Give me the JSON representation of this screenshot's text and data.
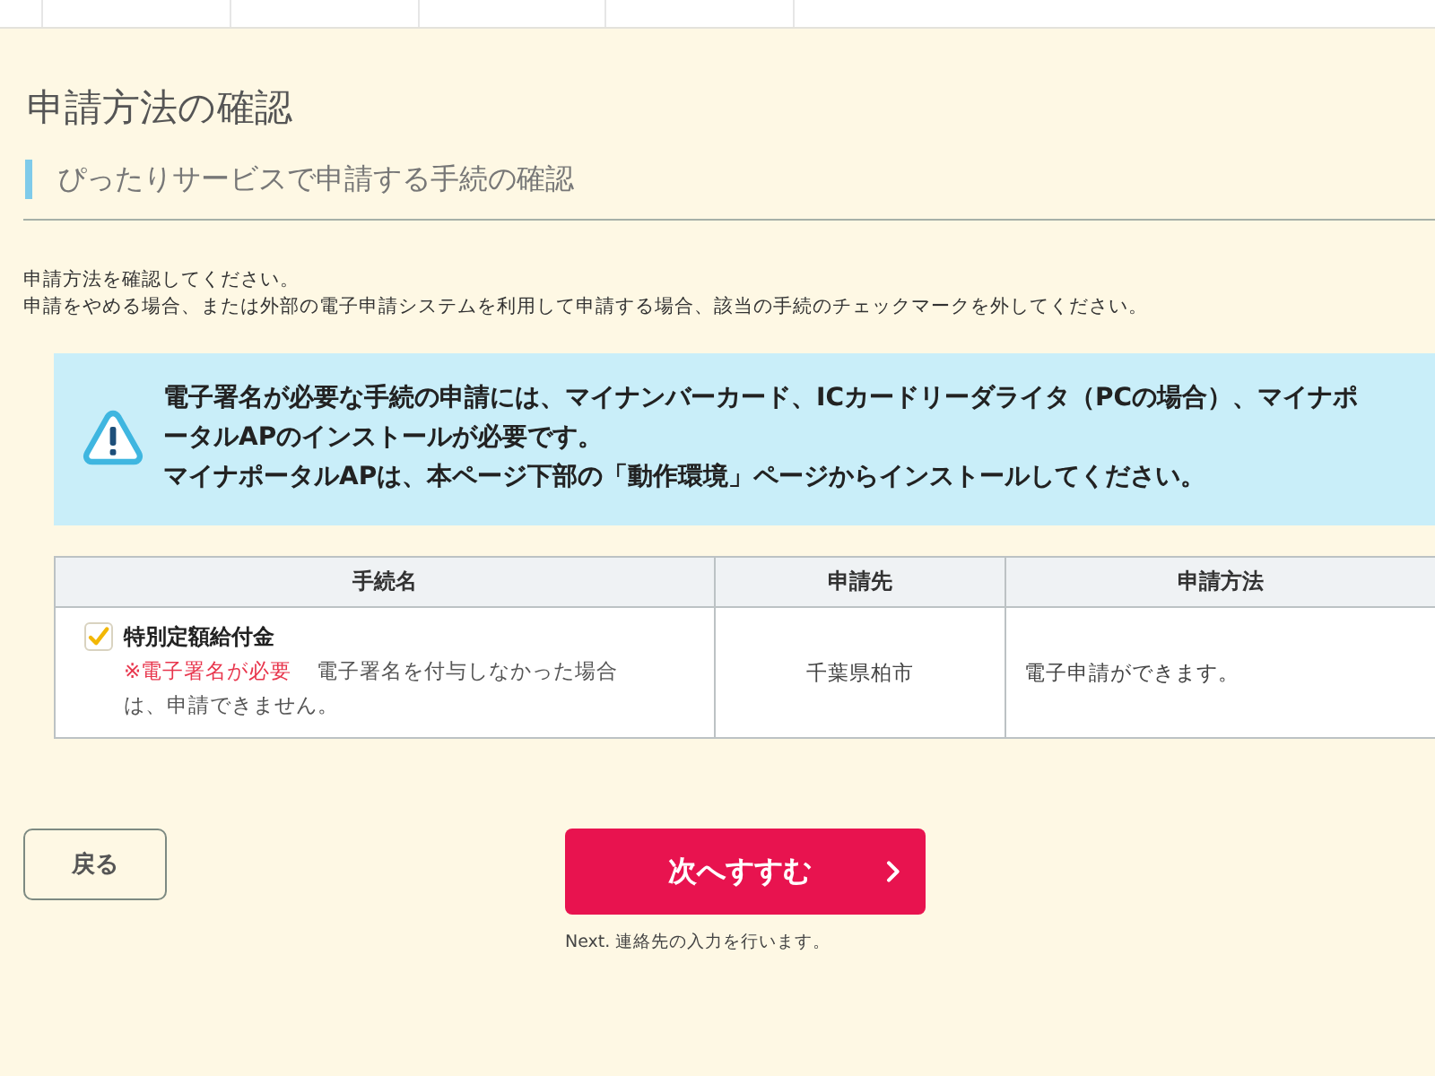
{
  "page": {
    "title": "申請方法の確認",
    "subtitle": "ぴったりサービスで申請する手続の確認"
  },
  "instructions": [
    "申請方法を確認してください。",
    "申請をやめる場合、または外部の電子申請システムを利用して申請する場合、該当の手続のチェックマークを外してください。"
  ],
  "notice": {
    "paragraphs": [
      "電子署名が必要な手続の申請には、マイナンバーカード、ICカードリーダライタ（PCの場合）、マイナポータルAPのインストールが必要です。",
      "マイナポータルAPは、本ページ下部の「動作環境」ページからインストールしてください。"
    ]
  },
  "table": {
    "columns": [
      "手続名",
      "申請先",
      "申請方法"
    ],
    "rows": [
      {
        "checked": true,
        "name": "特別定額給付金",
        "warning": "※電子署名が必要",
        "note": "電子署名を付与しなかった場合は、申請できません。",
        "destination": "千葉県柏市",
        "method": "電子申請ができます。"
      }
    ]
  },
  "buttons": {
    "back": "戻る",
    "next": "次へすすむ",
    "next_caption": "Next. 連絡先の入力を行います。"
  }
}
